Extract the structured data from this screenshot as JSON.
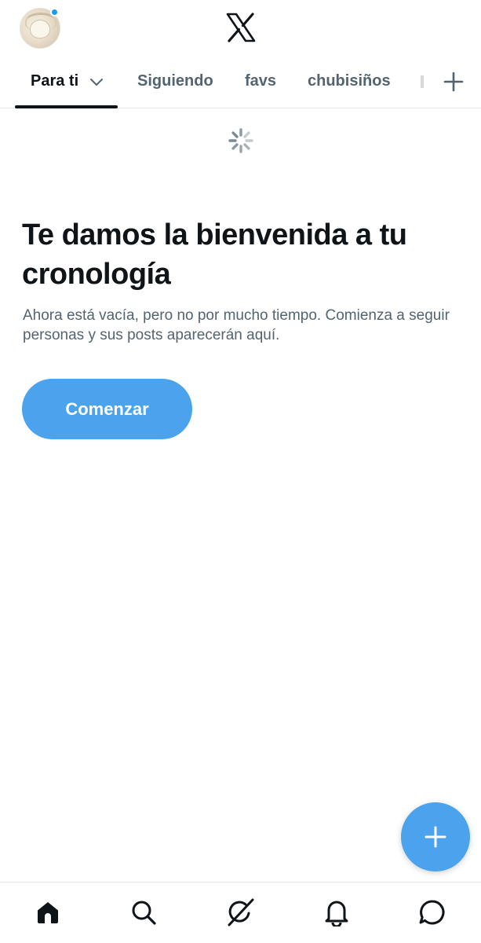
{
  "header": {
    "avatar_icon": "user-avatar",
    "logo_icon": "x-logo-icon",
    "notification_dot_color": "#1d9bf0"
  },
  "tabs": {
    "items": [
      {
        "label": "Para ti",
        "active": true,
        "has_dropdown": true
      },
      {
        "label": "Siguiendo",
        "active": false
      },
      {
        "label": "favs",
        "active": false
      },
      {
        "label": "chubisiños",
        "active": false
      }
    ],
    "add_icon": "plus-icon"
  },
  "loading": {
    "icon": "spinner-icon"
  },
  "welcome": {
    "title": "Te damos la bienvenida a tu cronología",
    "body": "Ahora está vacía, pero no por mucho tiempo. Comienza a seguir personas y sus posts aparecerán aquí.",
    "button_label": "Comenzar"
  },
  "fab": {
    "icon": "plus-icon"
  },
  "bottom_nav": {
    "items": [
      {
        "icon": "home-icon",
        "active": true
      },
      {
        "icon": "search-icon",
        "active": false
      },
      {
        "icon": "grok-icon",
        "active": false
      },
      {
        "icon": "bell-icon",
        "active": false
      },
      {
        "icon": "messages-icon",
        "active": false
      }
    ]
  },
  "colors": {
    "accent": "#4aa3ec",
    "text_primary": "#0f1419",
    "text_secondary": "#536471",
    "divider": "#e3e6e8"
  }
}
